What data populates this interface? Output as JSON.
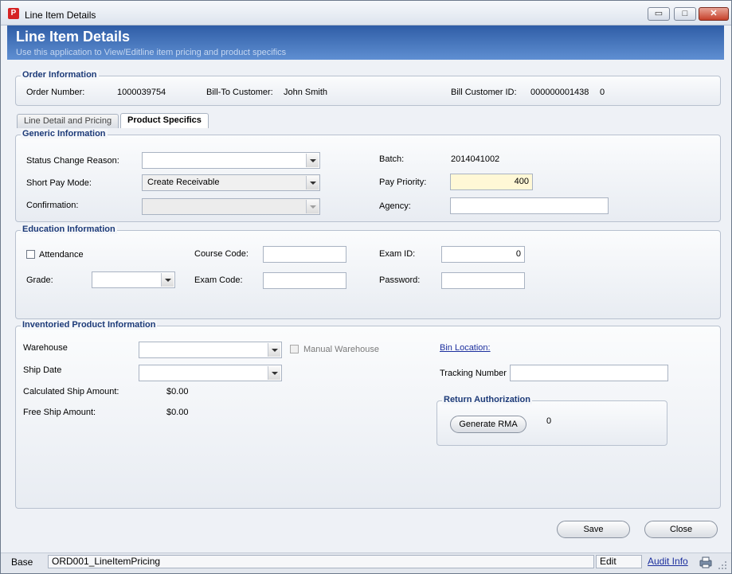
{
  "window": {
    "title": "Line Item Details",
    "minimize_glyph": "▭",
    "maximize_glyph": "□",
    "close_glyph": "✕"
  },
  "header": {
    "title": "Line Item Details",
    "subtitle": "Use this application to View/Editline item pricing and product specifics"
  },
  "order_info": {
    "section_title": "Order Information",
    "order_number_label": "Order Number:",
    "order_number": "1000039754",
    "bill_to_label": "Bill-To Customer:",
    "bill_to": "John Smith",
    "bill_id_label": "Bill Customer ID:",
    "bill_id": "000000001438",
    "bill_id_suffix": "0"
  },
  "tabs": [
    {
      "label": "Line Detail and Pricing",
      "active": false
    },
    {
      "label": "Product Specifics",
      "active": true
    }
  ],
  "generic": {
    "section_title": "Generic Information",
    "status_reason_label": "Status Change Reason:",
    "status_reason_value": "",
    "short_pay_label": "Short Pay Mode:",
    "short_pay_value": "Create Receivable",
    "confirmation_label": "Confirmation:",
    "confirmation_value": "",
    "batch_label": "Batch:",
    "batch_value": "2014041002",
    "pay_priority_label": "Pay Priority:",
    "pay_priority_value": "400",
    "agency_label": "Agency:",
    "agency_value": ""
  },
  "education": {
    "section_title": "Education Information",
    "attendance_label": "Attendance",
    "grade_label": "Grade:",
    "grade_value": "",
    "course_code_label": "Course Code:",
    "course_code_value": "",
    "exam_code_label": "Exam Code:",
    "exam_code_value": "",
    "exam_id_label": "Exam ID:",
    "exam_id_value": "0",
    "password_label": "Password:",
    "password_value": ""
  },
  "inventory": {
    "section_title": "Inventoried Product Information",
    "warehouse_label": "Warehouse",
    "warehouse_value": "",
    "manual_warehouse_label": "Manual Warehouse",
    "ship_date_label": "Ship Date",
    "ship_date_value": "",
    "calc_ship_label": "Calculated Ship Amount:",
    "calc_ship_value": "$0.00",
    "free_ship_label": "Free Ship Amount:",
    "free_ship_value": "$0.00",
    "bin_location_label": "Bin Location:",
    "tracking_label": "Tracking Number",
    "tracking_value": "",
    "rma": {
      "section_title": "Return Authorization",
      "button_label": "Generate RMA",
      "value": "0"
    }
  },
  "footer": {
    "save_label": "Save",
    "close_label": "Close"
  },
  "statusbar": {
    "base": "Base",
    "form_name": "ORD001_LineItemPricing",
    "mode": "Edit",
    "audit_label": "Audit Info"
  }
}
